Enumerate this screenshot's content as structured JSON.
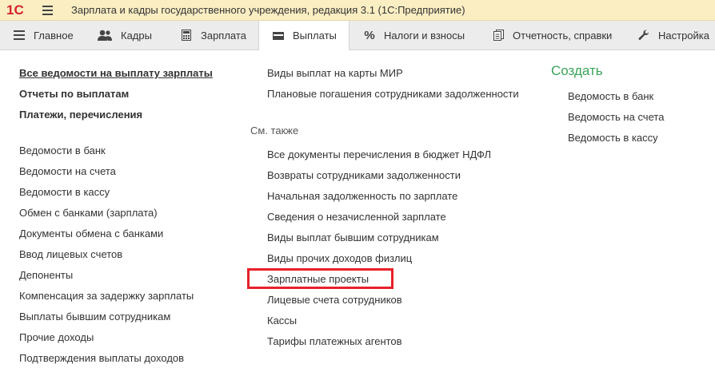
{
  "app": {
    "logo": "1С",
    "title": "Зарплата и кадры государственного учреждения, редакция 3.1  (1С:Предприятие)"
  },
  "tabs": [
    {
      "label": "Главное",
      "icon": "menu-lines-icon"
    },
    {
      "label": "Кадры",
      "icon": "people-icon"
    },
    {
      "label": "Зарплата",
      "icon": "calculator-icon"
    },
    {
      "label": "Выплаты",
      "icon": "wallet-icon",
      "active": true
    },
    {
      "label": "Налоги и взносы",
      "icon": "percent-icon"
    },
    {
      "label": "Отчетность, справки",
      "icon": "reports-icon"
    },
    {
      "label": "Настройка",
      "icon": "wrench-icon"
    }
  ],
  "left": {
    "main_links": [
      "Все ведомости на выплату зарплаты",
      "Отчеты по выплатам",
      "Платежи, перечисления"
    ],
    "links": [
      "Ведомости в банк",
      "Ведомости на счета",
      "Ведомости в кассу",
      "Обмен с банками (зарплата)",
      "Документы обмена с банками",
      "Ввод лицевых счетов",
      "Депоненты",
      "Компенсация за задержку зарплаты",
      "Выплаты бывшим сотрудникам",
      "Прочие доходы",
      "Подтверждения выплаты доходов"
    ]
  },
  "middle": {
    "links": [
      "Виды выплат на карты МИР",
      "Плановые погашения сотрудниками задолженности"
    ],
    "see_also_label": "См. также",
    "see_also": [
      "Все документы перечисления в бюджет НДФЛ",
      "Возвраты сотрудниками задолженности",
      "Начальная задолженность по зарплате",
      "Сведения о незачисленной зарплате",
      "Виды выплат бывшим сотрудникам",
      "Виды прочих доходов физлиц",
      "Зарплатные проекты",
      "Лицевые счета сотрудников",
      "Кассы",
      "Тарифы платежных агентов"
    ]
  },
  "right": {
    "create_label": "Создать",
    "links": [
      "Ведомость в банк",
      "Ведомость на счета",
      "Ведомость в кассу"
    ]
  },
  "colors": {
    "titlebar": "#fbeec3",
    "tabbar": "#ececec",
    "create": "#3aa35a",
    "highlight": "#e8202a",
    "logo": "#d5232a"
  }
}
